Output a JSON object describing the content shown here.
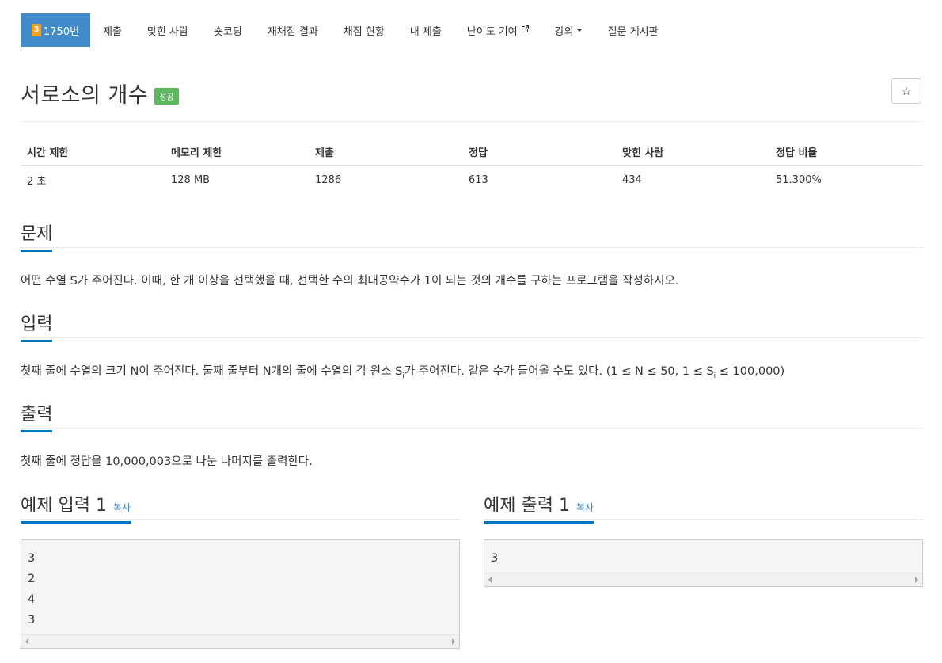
{
  "nav": {
    "problem_level": "3",
    "problem_number": "1750번",
    "items": [
      "제출",
      "맞힌 사람",
      "숏코딩",
      "재채점 결과",
      "채점 현황",
      "내 제출",
      "난이도 기여",
      "강의",
      "질문 게시판"
    ]
  },
  "title": {
    "text": "서로소의 개수",
    "status": "성공",
    "star_icon": "☆"
  },
  "stats": {
    "headers": [
      "시간 제한",
      "메모리 제한",
      "제출",
      "정답",
      "맞힌 사람",
      "정답 비율"
    ],
    "values": [
      "2 초",
      "128 MB",
      "1286",
      "613",
      "434",
      "51.300%"
    ]
  },
  "problem": {
    "heading": "문제",
    "text": "어떤 수열 S가 주어진다. 이때, 한 개 이상을 선택했을 때, 선택한 수의 최대공약수가 1이 되는 것의 개수를 구하는 프로그램을 작성하시오."
  },
  "input": {
    "heading": "입력",
    "text_before": "첫째 줄에 수열의 크기 N이 주어진다. 둘째 줄부터 N개의 줄에 수열의 각 원소 S",
    "text_sub1": "i",
    "text_middle": "가 주어진다. 같은 수가 들어올 수도 있다. (1 ≤ N ≤ 50, 1 ≤ S",
    "text_sub2": "i",
    "text_after": " ≤ 100,000)"
  },
  "output": {
    "heading": "출력",
    "text": "첫째 줄에 정답을 10,000,003으로 나눈 나머지를 출력한다."
  },
  "sample_input": {
    "heading": "예제 입력 1",
    "copy_label": "복사",
    "content": "3\n2\n4\n3"
  },
  "sample_output": {
    "heading": "예제 출력 1",
    "copy_label": "복사",
    "content": "3"
  },
  "colors": {
    "nav_active": "#428bca",
    "level_badge": "#f3a21b",
    "success_badge": "#5cb85c",
    "section_underline": "#0076c0"
  }
}
